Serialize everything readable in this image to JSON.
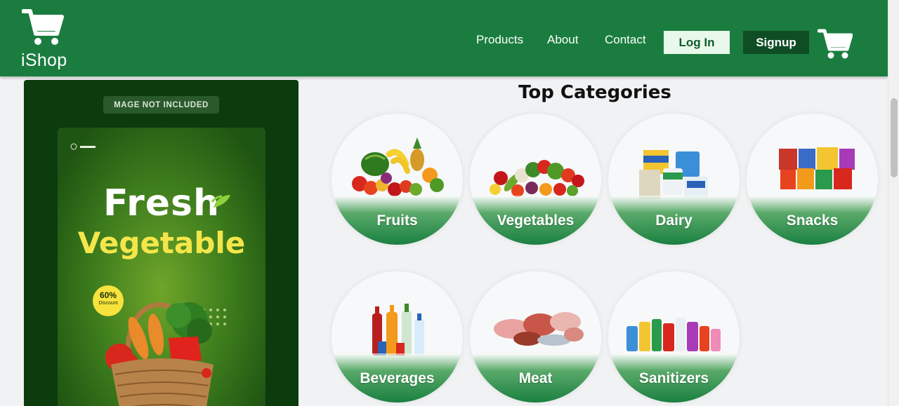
{
  "header": {
    "brand": "iShop",
    "nav": [
      "Products",
      "About",
      "Contact"
    ],
    "login_label": "Log In",
    "signup_label": "Signup"
  },
  "promo": {
    "badge": "MAGE NOT INCLUDED",
    "title_line1": "Fresh",
    "title_line2": "Vegetable",
    "discount_value": "60%",
    "discount_label": "Discount"
  },
  "categories": {
    "title": "Top Categories",
    "items": [
      "Fruits",
      "Vegetables",
      "Dairy",
      "Snacks",
      "Beverages",
      "Meat",
      "Sanitizers"
    ]
  },
  "colors": {
    "header_bg": "#1a7d3f",
    "accent": "#1a8040",
    "signup_bg": "#0f4d25",
    "login_bg": "#e8f8ea"
  }
}
